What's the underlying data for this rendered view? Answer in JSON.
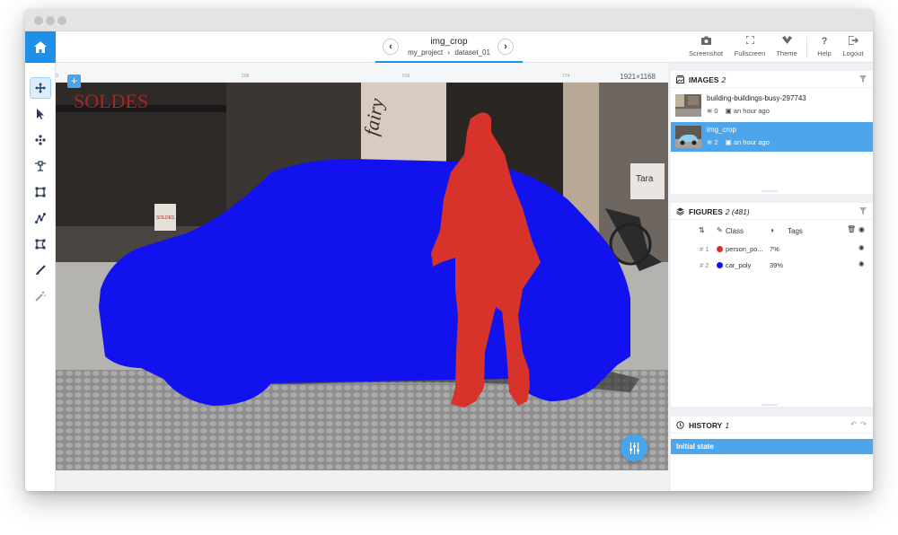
{
  "header": {
    "image_title": "img_crop",
    "project": "my_project",
    "breadcrumb_sep": "›",
    "dataset": "dataset_01",
    "prev_arrow": "‹",
    "next_arrow": "›",
    "tools": [
      {
        "label": "Screenshot",
        "icon": "camera-icon"
      },
      {
        "label": "Fullscreen",
        "icon": "fullscreen-icon"
      },
      {
        "label": "Theme",
        "icon": "theme-icon"
      },
      {
        "label": "Help",
        "icon": "help-icon"
      },
      {
        "label": "Logout",
        "icon": "logout-icon"
      }
    ],
    "help_glyph": "?"
  },
  "toolbar": {
    "tools": [
      "move-tool",
      "select-tool",
      "drag-points-tool",
      "point-tool",
      "rectangle-tool",
      "polyline-tool",
      "polygon-tool",
      "brush-tool",
      "magic-wand-tool"
    ],
    "active": "move-tool"
  },
  "canvas": {
    "image_size": "1921×1168",
    "add_label": "+",
    "ruler_ticks": [
      "0",
      "258",
      "516",
      "774"
    ],
    "shop_sign": "SOLDES",
    "store_name": "fairy",
    "store_sign": "Tara",
    "window_sign": "SOLDES",
    "figures": [
      {
        "class": "car_poly",
        "color": "#1212ee"
      },
      {
        "class": "person_poly",
        "color": "#d8332b"
      }
    ]
  },
  "images_panel": {
    "title": "IMAGES",
    "count": "2",
    "items": [
      {
        "name": "building-buildings-busy-297743",
        "figures": "0",
        "time": "an hour ago",
        "selected": false
      },
      {
        "name": "img_crop",
        "figures": "2",
        "time": "an hour ago",
        "selected": true
      }
    ]
  },
  "figures_panel": {
    "title": "FIGURES",
    "count": "2 (481)",
    "columns": {
      "class": "Class",
      "tags": "Tags"
    },
    "rows": [
      {
        "id": "# 1",
        "class": "person_po...",
        "area": "7%",
        "color": "#d8332b"
      },
      {
        "id": "# 2",
        "class": "car_poly",
        "area": "39%",
        "color": "#1212ee"
      }
    ]
  },
  "history_panel": {
    "title": "HISTORY",
    "count": "1",
    "items": [
      "Initial state"
    ]
  },
  "colors": {
    "accent": "#1e90e8",
    "selection": "#4da6ec",
    "car": "#1212ee",
    "person": "#d8332b"
  }
}
